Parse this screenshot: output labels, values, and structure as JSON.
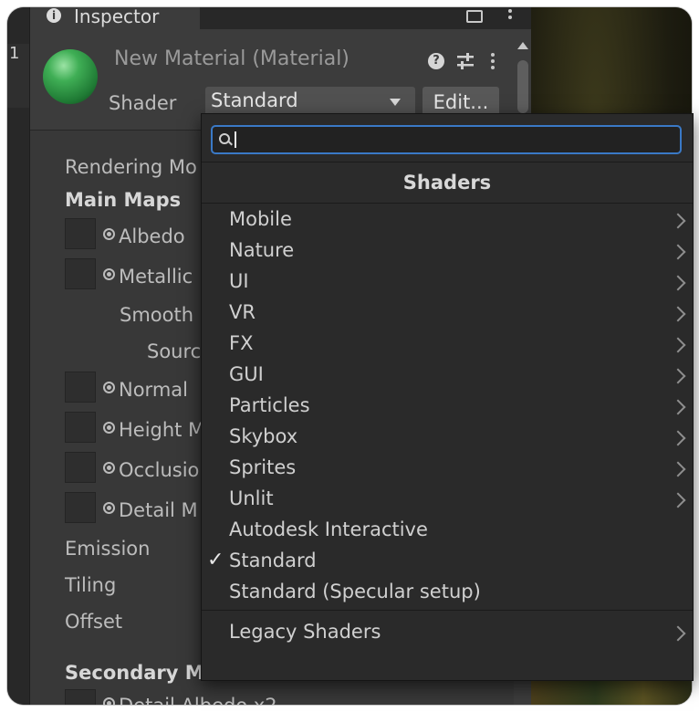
{
  "left_strip": {
    "number": "1"
  },
  "inspector": {
    "tab_title": "Inspector",
    "material_title": "New Material (Material)",
    "shader_label": "Shader",
    "shader_value": "Standard",
    "edit_label": "Edit...",
    "properties": {
      "rendering_mode": "Rendering Mo",
      "main_maps": "Main Maps",
      "albedo": "Albedo",
      "metallic": "Metallic",
      "smoothness": "Smooth",
      "source": "Sourc",
      "normal": "Normal",
      "height": "Height M",
      "occlusion": "Occlusio",
      "detail_mask": "Detail M",
      "emission": "Emission",
      "tiling": "Tiling",
      "offset": "Offset",
      "secondary_maps": "Secondary M",
      "detail_albedo": "Detail Albedo x2"
    }
  },
  "dropdown": {
    "search_value": "",
    "header": "Shaders",
    "items": [
      {
        "label": "Mobile",
        "submenu": true
      },
      {
        "label": "Nature",
        "submenu": true
      },
      {
        "label": "UI",
        "submenu": true
      },
      {
        "label": "VR",
        "submenu": true
      },
      {
        "label": "FX",
        "submenu": true
      },
      {
        "label": "GUI",
        "submenu": true
      },
      {
        "label": "Particles",
        "submenu": true
      },
      {
        "label": "Skybox",
        "submenu": true
      },
      {
        "label": "Sprites",
        "submenu": true
      },
      {
        "label": "Unlit",
        "submenu": true
      },
      {
        "label": "Autodesk Interactive",
        "submenu": false
      },
      {
        "label": "Standard",
        "submenu": false,
        "checked": true
      },
      {
        "label": "Standard (Specular setup)",
        "submenu": false
      }
    ],
    "legacy_label": "Legacy Shaders",
    "check_glyph": "✓"
  }
}
